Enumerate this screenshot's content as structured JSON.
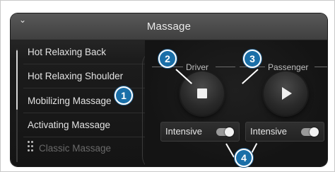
{
  "header": {
    "title": "Massage",
    "collapse_icon": "chevron-down-icon"
  },
  "sidebar": {
    "items": [
      {
        "label": "Hot Relaxing Back"
      },
      {
        "label": "Hot Relaxing Shoulder"
      },
      {
        "label": "Mobilizing Massage"
      },
      {
        "label": "Activating Massage"
      },
      {
        "label": "Classic Massage"
      }
    ],
    "drag_icon": "drag-handle-icon"
  },
  "seats": {
    "driver": {
      "label": "Driver",
      "button_icon": "stop-icon"
    },
    "passenger": {
      "label": "Passenger",
      "button_icon": "play-icon"
    }
  },
  "toggles": [
    {
      "label": "Intensive",
      "state": "on"
    },
    {
      "label": "Intensive",
      "state": "on"
    }
  ],
  "callouts": [
    "1",
    "2",
    "3",
    "4"
  ],
  "colors": {
    "callout_fill": "#1a6fa8",
    "screen_background": "#141414",
    "titlebar": "#4a4a4a"
  }
}
